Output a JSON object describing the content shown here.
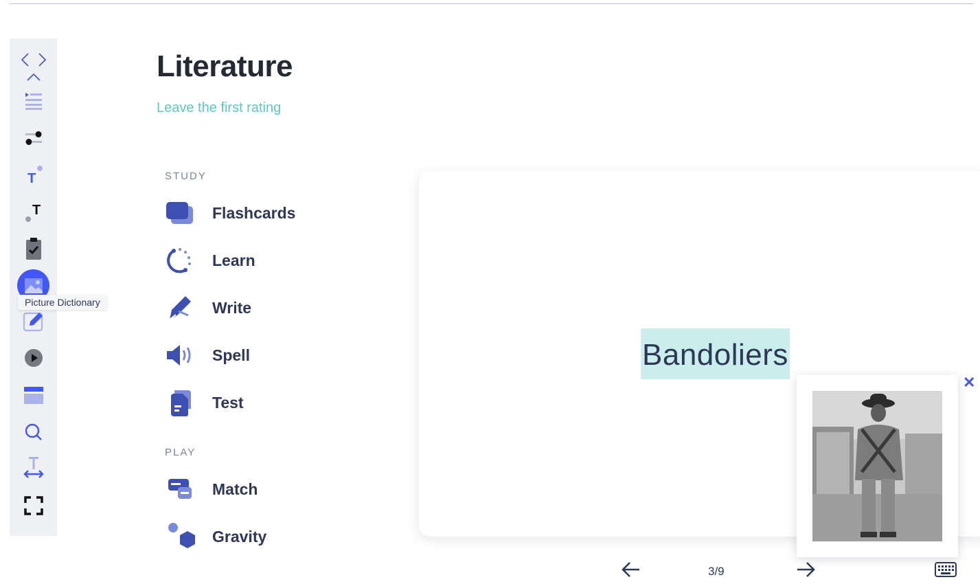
{
  "toolbar": {
    "tooltip": "Picture Dictionary",
    "tools": [
      {
        "icon": "code-arrows-icon"
      },
      {
        "icon": "collapse-chevron-icon"
      },
      {
        "icon": "line-focus-icon"
      },
      {
        "icon": "toggle-settings-icon"
      },
      {
        "icon": "text-size-icon"
      },
      {
        "icon": "text-spacing-icon"
      },
      {
        "icon": "clipboard-check-icon"
      },
      {
        "icon": "picture-dictionary-icon"
      },
      {
        "icon": "edit-note-icon"
      },
      {
        "icon": "play-circle-icon"
      },
      {
        "icon": "reading-mask-icon"
      },
      {
        "icon": "search-icon"
      },
      {
        "icon": "text-width-icon"
      },
      {
        "icon": "fullscreen-icon"
      }
    ]
  },
  "header": {
    "title": "Literature",
    "rating_link": "Leave the first rating"
  },
  "study": {
    "label": "STUDY",
    "modes": [
      {
        "label": "Flashcards",
        "icon": "flashcards-icon"
      },
      {
        "label": "Learn",
        "icon": "learn-icon"
      },
      {
        "label": "Write",
        "icon": "write-icon"
      },
      {
        "label": "Spell",
        "icon": "spell-icon"
      },
      {
        "label": "Test",
        "icon": "test-icon"
      }
    ]
  },
  "play": {
    "label": "PLAY",
    "modes": [
      {
        "label": "Match",
        "icon": "match-icon"
      },
      {
        "label": "Gravity",
        "icon": "gravity-icon"
      }
    ]
  },
  "flashcard": {
    "term": "Bandoliers"
  },
  "navigation": {
    "counter": "3/9"
  },
  "colors": {
    "brand_blue": "#4257f5",
    "icon_indigo": "#3d4fb0",
    "teal_link": "#5fc7c0",
    "highlight": "#c9eeec"
  }
}
